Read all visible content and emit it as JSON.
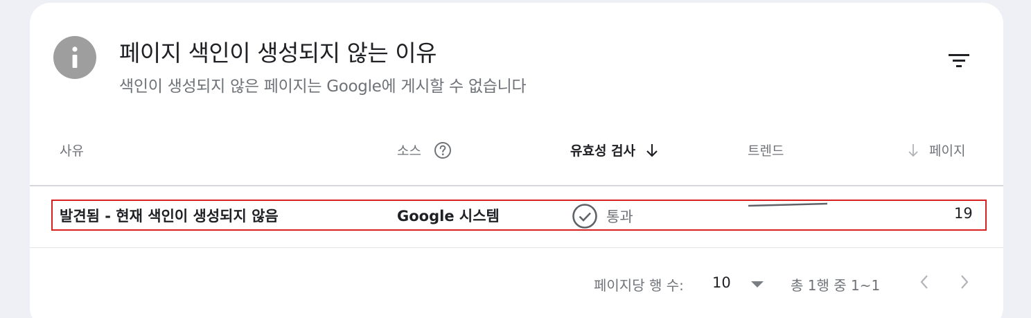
{
  "header": {
    "title": "페이지 색인이 생성되지 않는 이유",
    "subtitle": "색인이 생성되지 않은 페이지는 Google에 게시할 수 없습니다",
    "icon": "info-icon",
    "filter_icon": "filter-icon"
  },
  "table": {
    "columns": {
      "reason": "사유",
      "source": "소스",
      "validation": "유효성 검사",
      "trend": "트렌드",
      "pages": "페이지"
    },
    "rows": [
      {
        "reason": "발견됨 - 현재 색인이 생성되지 않음",
        "source": "Google 시스템",
        "validation_status": "통과",
        "pages": "19"
      }
    ]
  },
  "pagination": {
    "rows_per_page_label": "페이지당 행 수:",
    "rows_per_page_value": "10",
    "range": "총 1행 중 1~1"
  },
  "colors": {
    "highlight_border": "#d71f1f",
    "icon_gray": "#9e9e9e",
    "muted_text": "#6f7378"
  }
}
